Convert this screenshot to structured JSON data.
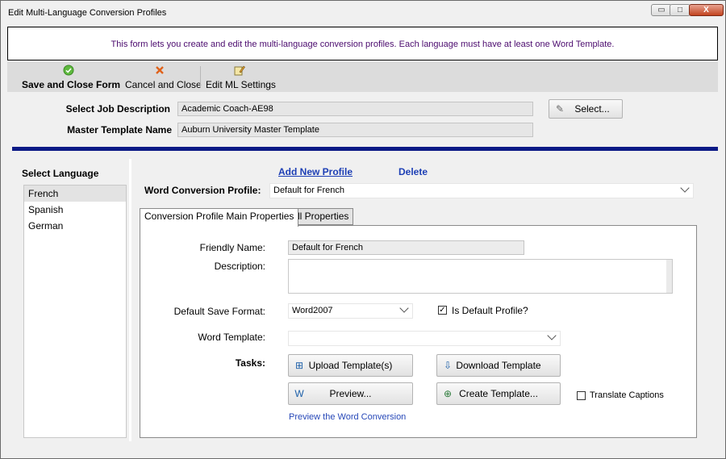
{
  "window": {
    "title": "Edit Multi-Language Conversion Profiles",
    "controls": {
      "minimize": "▭",
      "maximize": "□",
      "close": "X"
    }
  },
  "info_text": "This form lets you create and edit the multi-language conversion profiles. Each language must have at least one Word Template.",
  "toolbar": {
    "save_close": "Save and Close Form",
    "cancel_close": "Cancel and Close",
    "edit_ml": "Edit ML Settings",
    "icons": {
      "save": "check-circle-icon",
      "cancel": "x-icon",
      "edit": "edit-settings-icon"
    }
  },
  "header_fields": {
    "job_label": "Select Job Description",
    "job_value": "Academic Coach-AE98",
    "select_button": "Select...",
    "template_label": "Master Template Name",
    "template_value": "Auburn University Master Template"
  },
  "languages": {
    "label": "Select Language",
    "items": [
      "French",
      "Spanish",
      "German"
    ],
    "selected": "French"
  },
  "profile": {
    "add_link": "Add New Profile",
    "delete_link": "Delete",
    "label": "Word Conversion Profile:",
    "value": "Default for French"
  },
  "tabs": [
    "Conversion Profile Main Properties",
    "All Properties"
  ],
  "form": {
    "friendly_label": "Friendly Name:",
    "friendly_value": "Default for French",
    "description_label": "Description:",
    "description_value": "",
    "save_format_label": "Default Save Format:",
    "save_format_value": "Word2007",
    "is_default_label": "Is Default Profile?",
    "is_default_checked": true,
    "word_template_label": "Word Template:",
    "word_template_value": "",
    "tasks_label": "Tasks:",
    "upload_btn": "Upload Template(s)",
    "download_btn": "Download Template",
    "preview_btn": "Preview...",
    "create_btn": "Create Template...",
    "translate_label": "Translate Captions",
    "translate_checked": false,
    "preview_link": "Preview the Word Conversion"
  }
}
